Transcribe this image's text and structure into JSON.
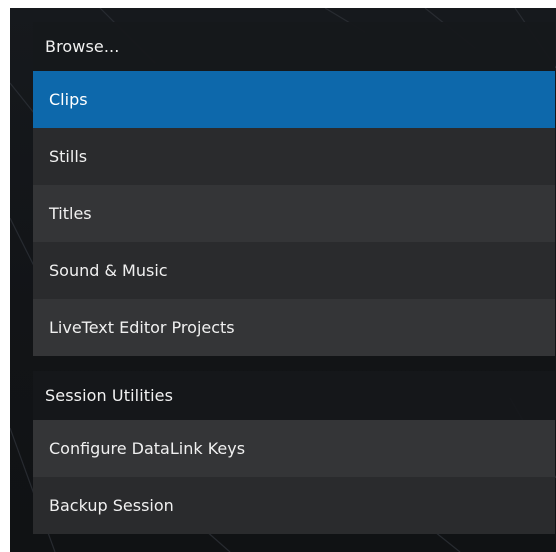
{
  "browse": {
    "header": "Browse...",
    "items": [
      {
        "label": "Clips"
      },
      {
        "label": "Stills"
      },
      {
        "label": "Titles"
      },
      {
        "label": "Sound & Music"
      },
      {
        "label": "LiveText Editor Projects"
      }
    ]
  },
  "session_utilities": {
    "header": "Session Utilities",
    "items": [
      {
        "label": "Configure DataLink Keys"
      },
      {
        "label": "Backup Session"
      }
    ]
  },
  "colors": {
    "selected": "#0d68ab",
    "row_dark": "#2a2b2d",
    "row_light": "#343537",
    "background": "#121417"
  }
}
